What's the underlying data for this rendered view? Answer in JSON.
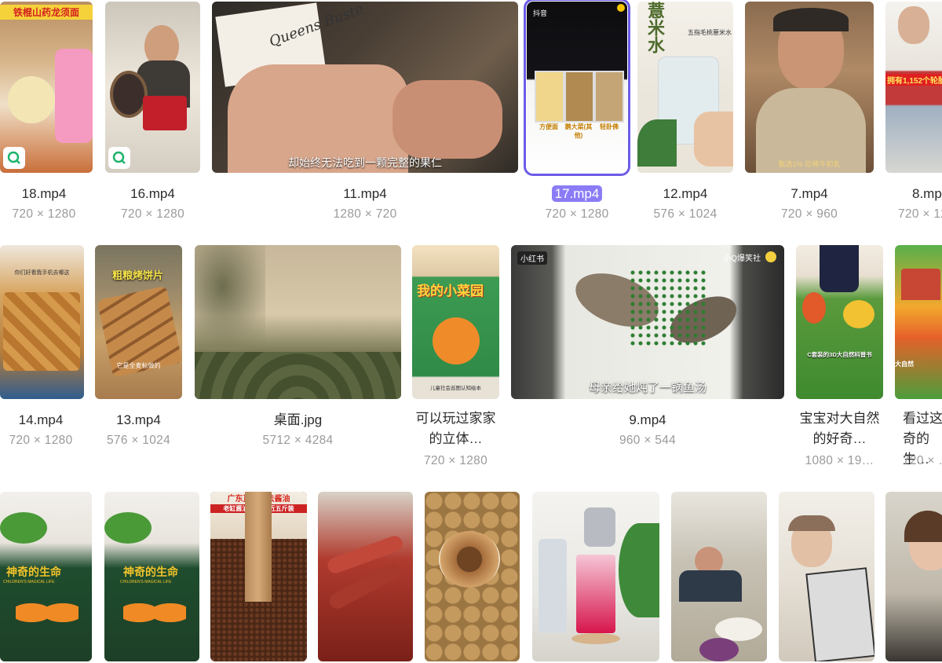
{
  "files": [
    {
      "name": "18.mp4",
      "dims": "720 × 1280"
    },
    {
      "name": "16.mp4",
      "dims": "720 × 1280"
    },
    {
      "name": "11.mp4",
      "dims": "1280 × 720",
      "caption": "却始终无法吃到一颗完整的果仁"
    },
    {
      "name": "17.mp4",
      "dims": "720 × 1280",
      "selected": true
    },
    {
      "name": "12.mp4",
      "dims": "576 × 1024"
    },
    {
      "name": "7.mp4",
      "dims": "720 × 960"
    },
    {
      "name": "8.mp4",
      "dims": "720 × 1280"
    },
    {
      "name": "14.mp4",
      "dims": "720 × 1280"
    },
    {
      "name": "13.mp4",
      "dims": "576 × 1024"
    },
    {
      "name": "桌面.jpg",
      "dims": "5712 × 4284"
    },
    {
      "name": "可以玩过家家的立体…",
      "dims": "720 × 1280"
    },
    {
      "name": "9.mp4",
      "dims": "960 × 544",
      "caption": "母亲给她炖了一锅鱼汤"
    },
    {
      "name": "宝宝对大自然的好奇…",
      "dims": "1080 × 19…"
    },
    {
      "name": "看过这奇的生…",
      "dims": "720 × …"
    }
  ],
  "thumb_text": {
    "t18_banner": "铁棍山药龙须面",
    "t11_sign": "Queens Buste",
    "t17_app": "抖音",
    "t17_l1": "方便面",
    "t17_l2": "鹅大菜(其他)",
    "t17_l3": "轻卧佛",
    "t12_sign": "薏米水",
    "t12_sub": "五指毛桃薏米水",
    "t7_sub": "甄选1%·珍稀牛初乳",
    "t8_banner": "拥有1,152个轮胎",
    "t13_title": "粗粮烤饼片",
    "t13_sub": "它是全麦标做的",
    "t14_top": "你们好看我手机去哪这",
    "tbook_title": "我的小菜园",
    "tbook_sub": "儿童社会巡图认知绘本",
    "t9_app": "小红书",
    "t9_user": "小Q爆笑社",
    "tbaby_sub": "C套装的3D大自然科普书",
    "tlast_sub": "大自然",
    "r3_book": "神奇的生命",
    "r3_book_en": "CHILDREN'S MAGICAL LIFE",
    "r3_c3_title": "广东直销古法酱油",
    "r3_c3_sub": "老缸酱油 到手将近五斤装"
  }
}
